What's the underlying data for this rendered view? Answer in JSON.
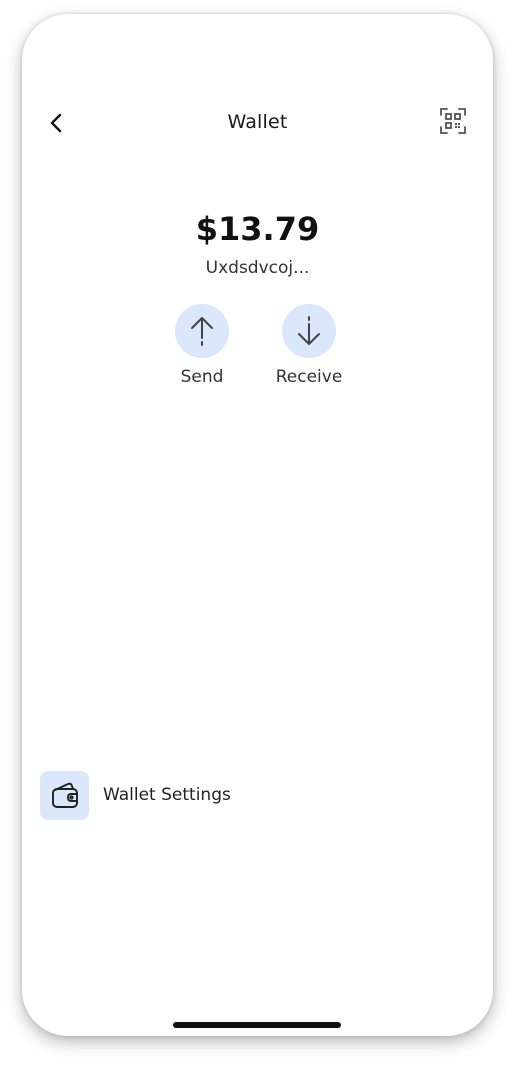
{
  "header": {
    "title": "Wallet",
    "back_icon": "chevron-left-icon",
    "qr_icon": "qr-scan-icon"
  },
  "wallet": {
    "balance": "$13.79",
    "address": "Uxdsdvcoj..."
  },
  "actions": [
    {
      "label": "Send",
      "icon": "arrow-up-icon"
    },
    {
      "label": "Receive",
      "icon": "arrow-down-icon"
    }
  ],
  "settings": {
    "label": "Wallet Settings",
    "icon": "wallet-icon"
  },
  "colors": {
    "accent_bg": "#dbe7fb",
    "text_primary": "#111111",
    "text_secondary": "#333333"
  }
}
